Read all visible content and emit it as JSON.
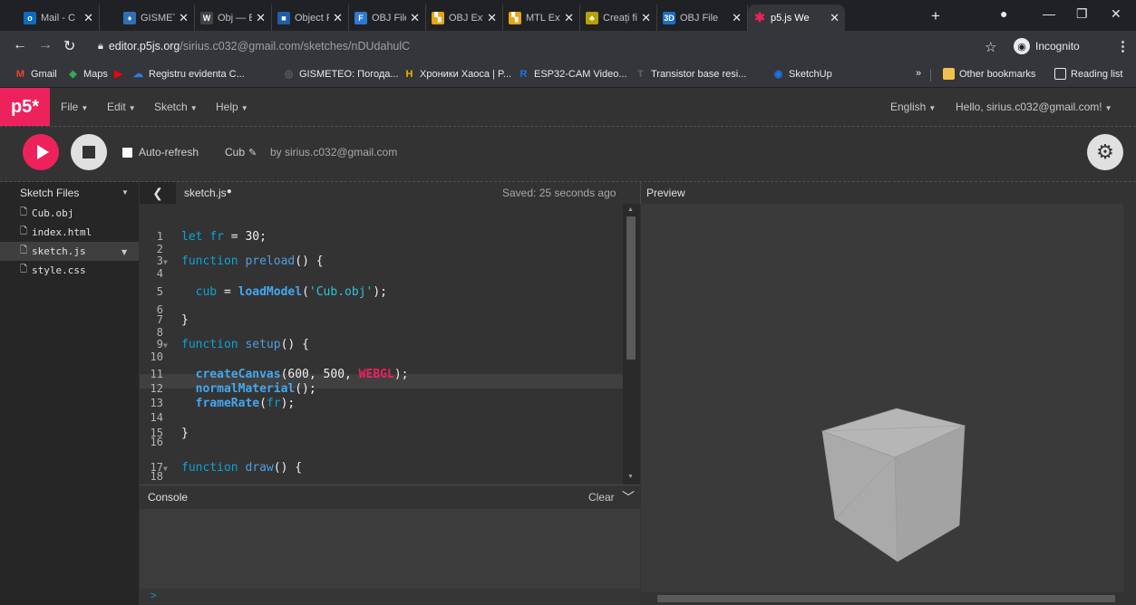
{
  "browser": {
    "tabs": [
      {
        "label": "Mail - C",
        "icon": "outlook-icon",
        "color": "#0f6cbd",
        "glyph": "o"
      },
      {
        "label": "GISMETE",
        "icon": "weather-drop-icon",
        "color": "#2f6fb5",
        "glyph": "♦"
      },
      {
        "label": "Obj — B",
        "icon": "w-icon",
        "color": "#444444",
        "glyph": "W"
      },
      {
        "label": "Object F",
        "icon": "object-icon",
        "color": "#1f5fa8",
        "glyph": "■"
      },
      {
        "label": "OBJ File",
        "icon": "file-icon",
        "color": "#2d7bd0",
        "glyph": "F"
      },
      {
        "label": "OBJ Exte",
        "icon": "ext-icon",
        "color": "#e8a317",
        "glyph": "▚"
      },
      {
        "label": "MTL Ext",
        "icon": "ext-icon",
        "color": "#e8a317",
        "glyph": "▚"
      },
      {
        "label": "Creați fi",
        "icon": "create-icon",
        "color": "#b8a000",
        "glyph": "♣"
      },
      {
        "label": "OBJ File",
        "icon": "3d-icon",
        "color": "#1a6fc9",
        "glyph": "3D"
      },
      {
        "label": "p5.js We",
        "icon": "p5-asterisk-icon",
        "color": "#ed225d",
        "glyph": "✱",
        "active": true
      }
    ],
    "new_tab": "+",
    "url_host": "editor.p5js.org",
    "url_path": "/sirius.c032@gmail.com/sketches/nDUdahulC",
    "incognito_label": "Incognito",
    "bookmarks": [
      {
        "label": "Gmail",
        "color": "#ea4335",
        "glyph": "M"
      },
      {
        "label": "Maps",
        "color": "#34a853",
        "glyph": "◆"
      },
      {
        "label": "",
        "color": "#ff0000",
        "glyph": "▶"
      },
      {
        "label": "Registru evidenta C...",
        "color": "#2b7de9",
        "glyph": "☁"
      },
      {
        "label": "GISMETEO: Погода...",
        "color": "#5f6368",
        "glyph": "◎"
      },
      {
        "label": "Хроники Хаоса | P...",
        "color": "#e8b400",
        "glyph": "H"
      },
      {
        "label": "ESP32-CAM Video...",
        "color": "#1a73e8",
        "glyph": "R"
      },
      {
        "label": "Transistor base resi...",
        "color": "#5f6368",
        "glyph": "T"
      },
      {
        "label": "SketchUp",
        "color": "#1a73e8",
        "glyph": "◉"
      }
    ],
    "bookmarks_more": "»",
    "other_bookmarks": "Other bookmarks",
    "reading_list": "Reading list"
  },
  "p5": {
    "logo": "p5*",
    "menu": [
      "File",
      "Edit",
      "Sketch",
      "Help"
    ],
    "language": "English",
    "greeting": "Hello, sirius.c032@gmail.com!",
    "auto_refresh_label": "Auto-refresh",
    "auto_refresh_checked": false,
    "sketch_name": "Cub",
    "byline": "by sirius.c032@gmail.com",
    "sidebar_title": "Sketch Files",
    "files": [
      "Cub.obj",
      "index.html",
      "sketch.js",
      "style.css"
    ],
    "selected_file": "sketch.js",
    "editor_tab": "sketch.js",
    "unsaved_dot": "●",
    "saved_status": "Saved: 25 seconds ago",
    "preview_title": "Preview",
    "console_title": "Console",
    "console_clear": "Clear",
    "console_prompt": ">",
    "accent": "#ed225d"
  },
  "code": [
    {
      "n": "1",
      "text": "let fr = 30;"
    },
    {
      "n": "2",
      "text": ""
    },
    {
      "n": "3",
      "text": "function preload() {",
      "fold": true
    },
    {
      "n": "4",
      "text": ""
    },
    {
      "n": "5",
      "text": "  cub = loadModel('Cub.obj');"
    },
    {
      "n": "6",
      "text": ""
    },
    {
      "n": "7",
      "text": "}"
    },
    {
      "n": "8",
      "text": ""
    },
    {
      "n": "9",
      "text": "function setup() {",
      "fold": true
    },
    {
      "n": "10",
      "text": ""
    },
    {
      "n": "11",
      "text": "  createCanvas(600, 500, WEBGL);",
      "current": true
    },
    {
      "n": "12",
      "text": "  normalMaterial();"
    },
    {
      "n": "13",
      "text": "  frameRate(fr);"
    },
    {
      "n": "14",
      "text": ""
    },
    {
      "n": "15",
      "text": "}"
    },
    {
      "n": "16",
      "text": ""
    },
    {
      "n": "17",
      "text": "function draw() {",
      "fold": true
    },
    {
      "n": "18",
      "text": ""
    }
  ]
}
